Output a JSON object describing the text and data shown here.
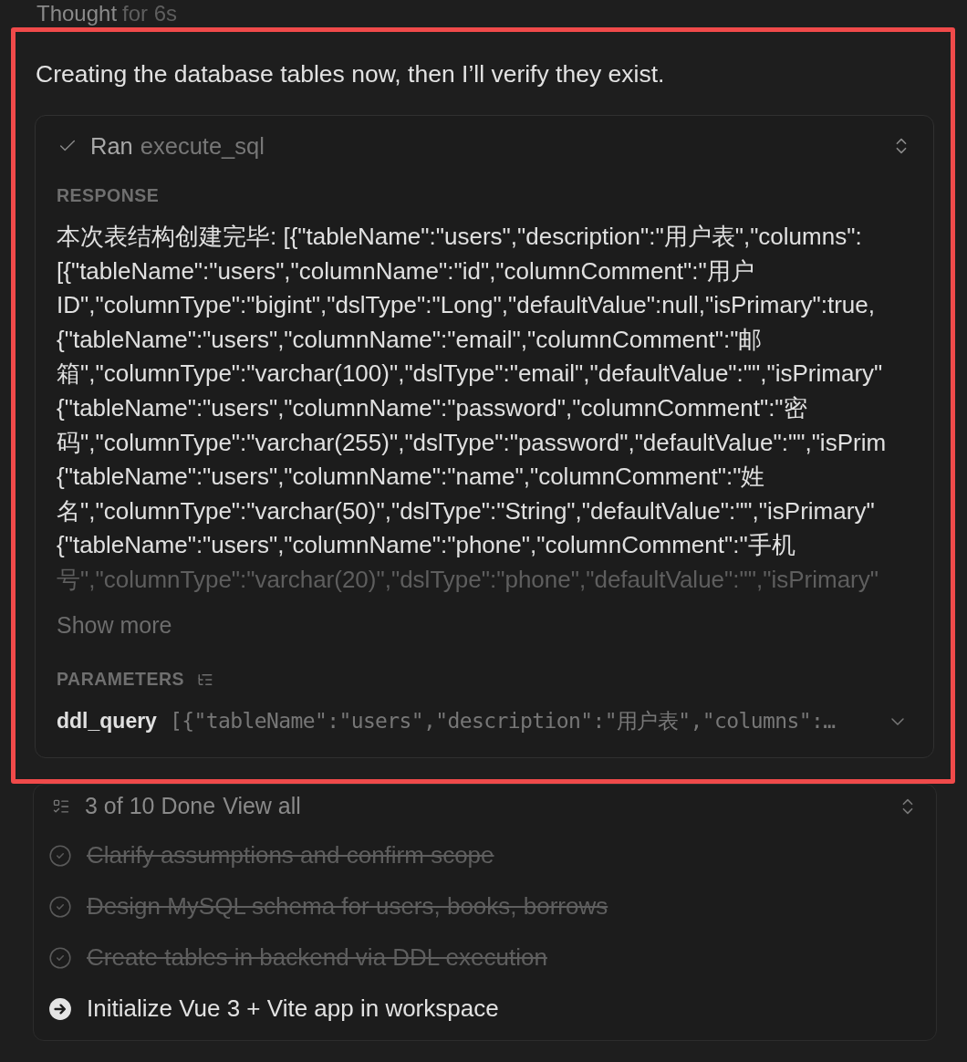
{
  "thought": {
    "label": "Thought",
    "duration": "for 6s"
  },
  "message": "Creating the database tables now, then I’ll verify they exist.",
  "tool_call": {
    "status": "Ran",
    "tool": "execute_sql",
    "done": true,
    "response_label": "RESPONSE",
    "response_lines": [
      "本次表结构创建完毕: [{\"tableName\":\"users\",\"description\":\"用户表\",\"columns\":",
      "[{\"tableName\":\"users\",\"columnName\":\"id\",\"columnComment\":\"用户",
      "ID\",\"columnType\":\"bigint\",\"dslType\":\"Long\",\"defaultValue\":null,\"isPrimary\":true,",
      "{\"tableName\":\"users\",\"columnName\":\"email\",\"columnComment\":\"邮",
      "箱\",\"columnType\":\"varchar(100)\",\"dslType\":\"email\",\"defaultValue\":\"\",\"isPrimary\"",
      "{\"tableName\":\"users\",\"columnName\":\"password\",\"columnComment\":\"密",
      "码\",\"columnType\":\"varchar(255)\",\"dslType\":\"password\",\"defaultValue\":\"\",\"isPrim",
      "{\"tableName\":\"users\",\"columnName\":\"name\",\"columnComment\":\"姓",
      "名\",\"columnType\":\"varchar(50)\",\"dslType\":\"String\",\"defaultValue\":\"\",\"isPrimary\"",
      "{\"tableName\":\"users\",\"columnName\":\"phone\",\"columnComment\":\"手机",
      "号\",\"columnType\":\"varchar(20)\",\"dslType\":\"phone\",\"defaultValue\":\"\",\"isPrimary\""
    ],
    "show_more": "Show more",
    "parameters_label": "PARAMETERS",
    "parameters": [
      {
        "name": "ddl_query",
        "value": "[{\"tableName\":\"users\",\"description\":\"用户表\",\"columns\":…",
        "expanded": false
      }
    ]
  },
  "todos": {
    "summary": "3 of 10 Done",
    "view_all": "View all",
    "items": [
      {
        "text": "Clarify assumptions and confirm scope",
        "done": true
      },
      {
        "text": "Design MySQL schema for users, books, borrows",
        "done": true
      },
      {
        "text": "Create tables in backend via DDL execution",
        "done": true
      },
      {
        "text": "Initialize Vue 3 + Vite app in workspace",
        "done": false
      }
    ]
  }
}
